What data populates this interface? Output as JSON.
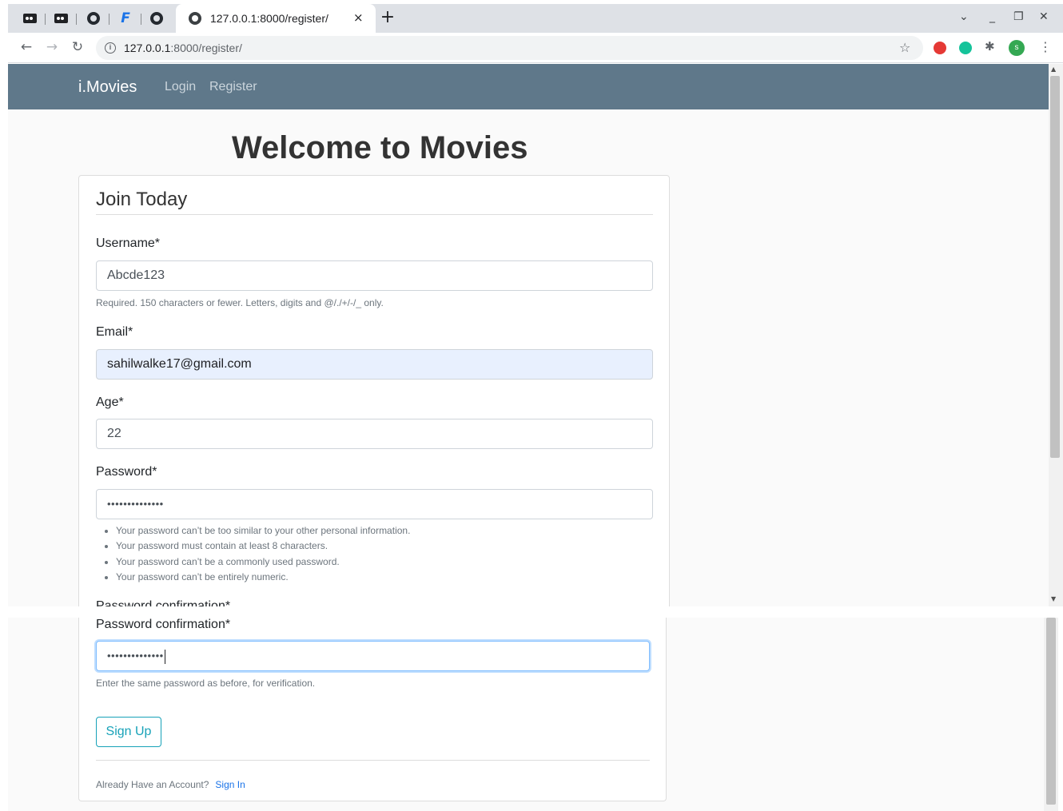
{
  "browser": {
    "tab_title": "127.0.0.1:8000/register/",
    "tab_close": "×",
    "new_tab": "+",
    "url_host": "127.0.0.1",
    "url_path": ":8000/register/",
    "avatar_letter": "s",
    "icons": [
      "dark-circle-icon",
      "github-icon",
      "f-logo-icon",
      "globe-icon",
      "info-icon",
      "star-icon",
      "opera-icon",
      "grammarly-icon",
      "puzzle-icon",
      "kebab-menu-icon"
    ]
  },
  "navbar": {
    "brand": "i.Movies",
    "links": [
      "Login",
      "Register"
    ],
    "color": "#5f788a"
  },
  "page": {
    "heading": "Welcome to Movies"
  },
  "form": {
    "legend": "Join Today",
    "username": {
      "label": "Username*",
      "value": "Abcde123",
      "help": "Required. 150 characters or fewer. Letters, digits and @/./+/-/_ only."
    },
    "email": {
      "label": "Email*",
      "value": "sahilwalke17@gmail.com"
    },
    "age": {
      "label": "Age*",
      "value": "22"
    },
    "password": {
      "label": "Password*",
      "value": "••••••••••••••",
      "help": [
        "Your password can’t be too similar to your other personal information.",
        "Your password must contain at least 8 characters.",
        "Your password can’t be a commonly used password.",
        "Your password can’t be entirely numeric."
      ]
    },
    "password_confirmation": {
      "label": "Password confirmation*",
      "value": "••••••••••••••",
      "help": "Enter the same password as before, for verification."
    },
    "submit_label": "Sign Up",
    "already": "Already Have an Account?",
    "signin": "Sign In",
    "button_color": "#17a2b8"
  }
}
